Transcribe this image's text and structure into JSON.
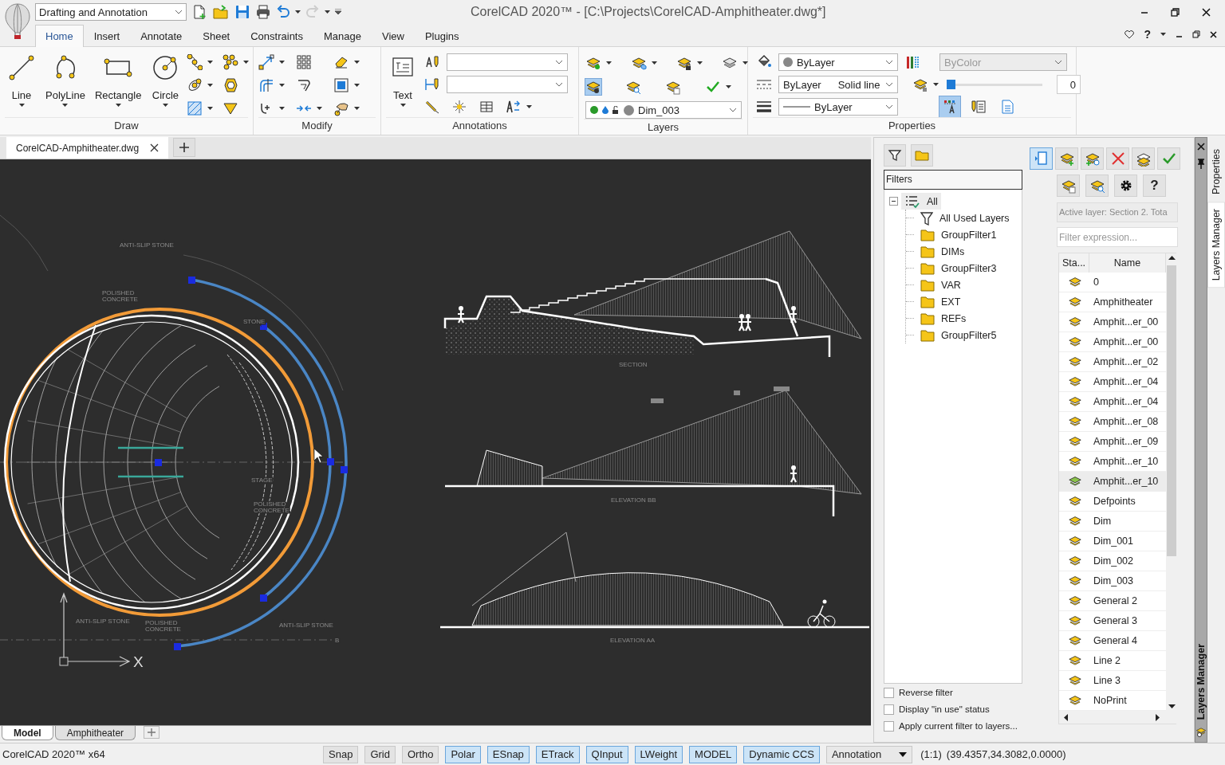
{
  "window": {
    "title": "CorelCAD 2020™ - [C:\\Projects\\CorelCAD-Amphitheater.dwg*]"
  },
  "workspace": "Drafting and Annotation",
  "quick_access": {
    "redo_disabled": true
  },
  "ribbon_tabs": [
    {
      "label": "Home",
      "selected": true
    },
    {
      "label": "Insert",
      "selected": false
    },
    {
      "label": "Annotate",
      "selected": false
    },
    {
      "label": "Sheet",
      "selected": false
    },
    {
      "label": "Constraints",
      "selected": false
    },
    {
      "label": "Manage",
      "selected": false
    },
    {
      "label": "View",
      "selected": false
    },
    {
      "label": "Plugins",
      "selected": false
    }
  ],
  "help": "?",
  "draw": {
    "title": "Draw",
    "tools": [
      "Line",
      "PolyLine",
      "Rectangle",
      "Circle"
    ]
  },
  "modify": {
    "title": "Modify"
  },
  "annotations": {
    "title": "Annotations",
    "text_tool": "Text"
  },
  "layers": {
    "title": "Layers",
    "buttons": [
      {
        "on": false
      },
      {
        "on": false
      },
      {
        "on": false
      },
      {
        "on": false
      },
      {
        "on": true
      },
      {
        "on": false
      },
      {
        "on": false
      },
      {
        "on": false
      }
    ],
    "current_layer": "Dim_003"
  },
  "properties": {
    "title": "Properties",
    "color_setting": "ByLayer",
    "linetype": "ByLayer",
    "linetype_name": "Solid line",
    "lineweight": "ByLayer",
    "plot_style": {
      "value": "ByColor",
      "disabled": true
    },
    "transparency": {
      "level": 0,
      "value": "0"
    },
    "buttons": [
      {
        "on": true
      },
      {
        "on": false
      },
      {
        "on": false
      }
    ]
  },
  "document_tabs": [
    {
      "label": "CorelCAD-Amphitheater.dwg",
      "selected": true
    }
  ],
  "drawing": {
    "labels": [
      "ANTI-SLIP STONE",
      "POLISHED",
      "CONCRETE",
      "STONE",
      "SECTION",
      "STAGE",
      "ELEVATION  BB",
      "POLISHED",
      "CONCRETE",
      "ANTI-SLIP STONE",
      "POLISHED",
      "ANTI-SLIP STONE",
      "CONCRETE",
      "B",
      "ELEVATION  AA"
    ],
    "axis_label": "X"
  },
  "layout_tabs": [
    {
      "label": "Model",
      "selected": true
    },
    {
      "label": "Amphitheater",
      "selected": false
    }
  ],
  "layers_manager": {
    "left_toolbar": [
      {
        "on": false
      },
      {
        "on": false
      }
    ],
    "filters_title": "Filters",
    "filter_tree": [
      {
        "label": "All",
        "kind": "all",
        "selected": true,
        "expanded": true,
        "children": [
          {
            "label": "All Used Layers",
            "kind": "filter",
            "selected": false
          },
          {
            "label": "GroupFilter1",
            "kind": "group",
            "selected": false
          },
          {
            "label": "DIMs",
            "kind": "group",
            "selected": false
          },
          {
            "label": "GroupFilter3",
            "kind": "group",
            "selected": false
          },
          {
            "label": "VAR",
            "kind": "group",
            "selected": false
          },
          {
            "label": "EXT",
            "kind": "group",
            "selected": false
          },
          {
            "label": "REFs",
            "kind": "group",
            "selected": false
          },
          {
            "label": "GroupFilter5",
            "kind": "group",
            "selected": false
          }
        ]
      }
    ],
    "options": [
      {
        "label": "Reverse filter",
        "checked": false
      },
      {
        "label": "Display \"in use\" status",
        "checked": false
      },
      {
        "label": "Apply current filter to layers...",
        "checked": false
      }
    ],
    "toolbar": [
      {
        "on": true
      },
      {
        "on": false
      },
      {
        "on": false
      },
      {
        "on": false
      },
      {
        "on": false
      },
      {
        "on": false
      },
      {
        "on": false
      },
      {
        "on": false
      },
      {
        "on": false
      },
      {
        "on": false,
        "label": "?"
      }
    ],
    "active_layer": "Active layer: Section 2. Tota",
    "filter_placeholder": "Filter expression...",
    "columns": [
      "Sta...",
      "Name"
    ],
    "layers": [
      {
        "name": "0",
        "selected": false
      },
      {
        "name": "Amphitheater",
        "selected": false
      },
      {
        "name": "Amphit...er_00",
        "selected": false
      },
      {
        "name": "Amphit...er_00",
        "selected": false
      },
      {
        "name": "Amphit...er_02",
        "selected": false
      },
      {
        "name": "Amphit...er_04",
        "selected": false
      },
      {
        "name": "Amphit...er_04",
        "selected": false
      },
      {
        "name": "Amphit...er_08",
        "selected": false
      },
      {
        "name": "Amphit...er_09",
        "selected": false
      },
      {
        "name": "Amphit...er_10",
        "selected": false
      },
      {
        "name": "Amphit...er_10",
        "selected": true
      },
      {
        "name": "Defpoints",
        "selected": false
      },
      {
        "name": "Dim",
        "selected": false
      },
      {
        "name": "Dim_001",
        "selected": false
      },
      {
        "name": "Dim_002",
        "selected": false
      },
      {
        "name": "Dim_003",
        "selected": false
      },
      {
        "name": "General 2",
        "selected": false
      },
      {
        "name": "General 3",
        "selected": false
      },
      {
        "name": "General 4",
        "selected": false
      },
      {
        "name": "Line 2",
        "selected": false
      },
      {
        "name": "Line 3",
        "selected": false
      },
      {
        "name": "NoPrint",
        "selected": false
      }
    ]
  },
  "dock_title": "Layers Manager",
  "side_tabs": [
    {
      "label": "Properties",
      "selected": false
    },
    {
      "label": "Layers Manager",
      "selected": true
    }
  ],
  "status_bar": {
    "app": "CorelCAD 2020™ x64",
    "toggles": [
      {
        "label": "Snap",
        "on": false
      },
      {
        "label": "Grid",
        "on": false
      },
      {
        "label": "Ortho",
        "on": false
      },
      {
        "label": "Polar",
        "on": true
      },
      {
        "label": "ESnap",
        "on": true
      },
      {
        "label": "ETrack",
        "on": true
      },
      {
        "label": "QInput",
        "on": true
      },
      {
        "label": "LWeight",
        "on": true
      },
      {
        "label": "MODEL",
        "on": true
      },
      {
        "label": "Dynamic CCS",
        "on": true
      }
    ],
    "annotation": "Annotation",
    "scale": "(1:1)",
    "coordinates": "(39.4357,34.3082,0.0000)"
  }
}
